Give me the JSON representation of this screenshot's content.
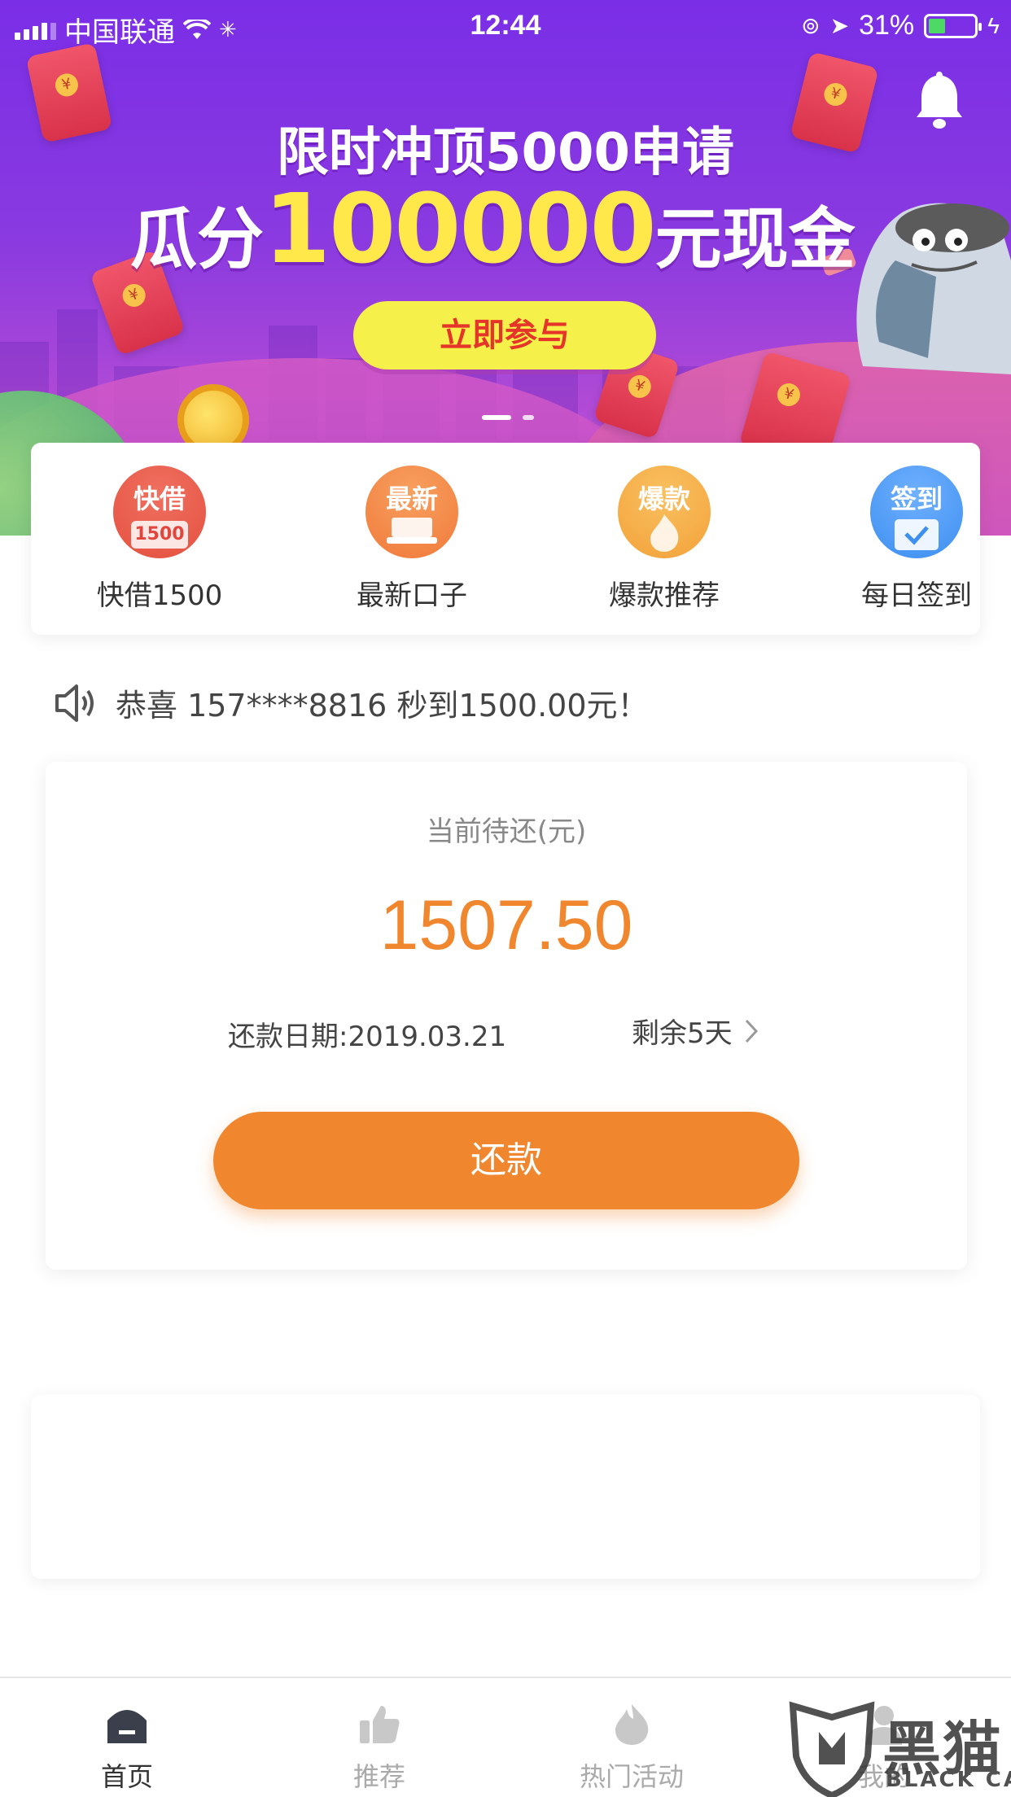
{
  "status_bar": {
    "carrier": "中国联通",
    "time": "12:44",
    "battery": "31%"
  },
  "banner": {
    "headline_line1": "限时冲顶5000申请",
    "headline_prefix": "瓜分",
    "headline_amount": "100000",
    "headline_suffix": "元现金",
    "cta_label": "立即参与",
    "slide_count": 2,
    "active_slide": 1
  },
  "quick_entries": [
    {
      "icon_text": "快借",
      "icon_sub": "1500",
      "label": "快借1500",
      "color": "#e4503f"
    },
    {
      "icon_text": "最新",
      "icon_sub": "",
      "label": "最新口子",
      "color": "#f07a3a"
    },
    {
      "icon_text": "爆款",
      "icon_sub": "",
      "label": "爆款推荐",
      "color": "#f3a23a"
    },
    {
      "icon_text": "签到",
      "icon_sub": "",
      "label": "每日签到",
      "color": "#3d8ff0"
    }
  ],
  "notice": {
    "text": "恭喜 157****8816 秒到1500.00元！"
  },
  "repay": {
    "label": "当前待还(元)",
    "amount": "1507.50",
    "date": "还款日期:2019.03.21",
    "remaining": "剩余5天",
    "button_label": "还款"
  },
  "tabbar": {
    "tabs": [
      {
        "label": "首页",
        "icon": "home-icon",
        "active": true
      },
      {
        "label": "推荐",
        "icon": "thumbs-up-icon",
        "active": false
      },
      {
        "label": "热门活动",
        "icon": "flame-icon",
        "active": false
      },
      {
        "label": "我的",
        "icon": "user-icon",
        "active": false
      }
    ]
  },
  "watermark": {
    "text": "黑猫",
    "sub": "BLACK CAT"
  },
  "colors": {
    "accent": "#f0872f",
    "banner_purple": "#7a2ee6",
    "cta_yellow": "#f5f04a"
  }
}
